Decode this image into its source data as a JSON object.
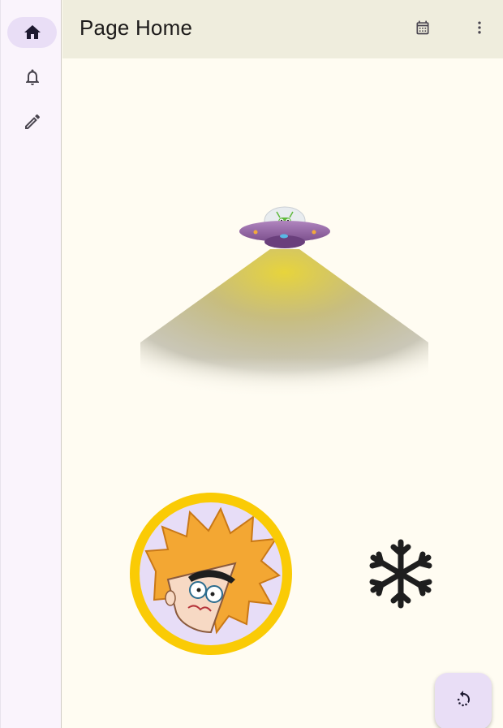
{
  "app_bar": {
    "title": "Page Home",
    "actions": [
      {
        "icon": "calendar-icon"
      },
      {
        "icon": "more-vert-icon"
      }
    ],
    "background": "#EFEDDD"
  },
  "navigation_rail": {
    "items": [
      {
        "icon": "home-icon",
        "selected": true
      },
      {
        "icon": "bell-icon",
        "selected": false
      },
      {
        "icon": "pencil-icon",
        "selected": false
      }
    ],
    "background": "#FAF4FC",
    "indicator_color": "#E9DEF6"
  },
  "content": {
    "illustration": "ufo-with-light-beam",
    "avatar": {
      "icon": "cartoon-boy-avatar",
      "ring_color": "#FACB05",
      "background": "#E7DDF7"
    },
    "decoration_icon": "snowflake-icon",
    "background": "#FFFCF2"
  },
  "fab": {
    "icon": "refresh-icon",
    "background": "#E9DEF6"
  }
}
